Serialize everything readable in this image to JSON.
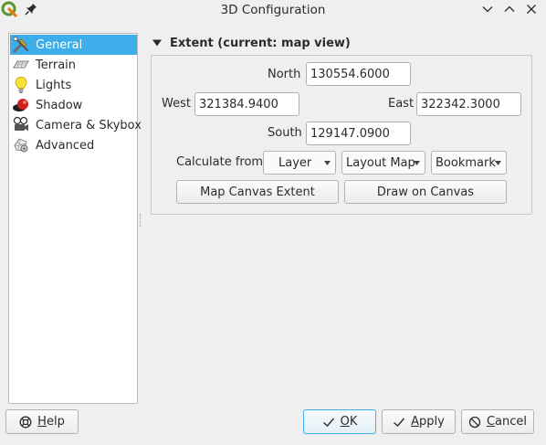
{
  "window": {
    "title": "3D Configuration"
  },
  "sidebar": {
    "items": [
      {
        "label": "General",
        "icon": "general-icon",
        "selected": true
      },
      {
        "label": "Terrain",
        "icon": "terrain-icon",
        "selected": false
      },
      {
        "label": "Lights",
        "icon": "lightbulb-icon",
        "selected": false
      },
      {
        "label": "Shadow",
        "icon": "shadow-icon",
        "selected": false
      },
      {
        "label": "Camera & Skybox",
        "icon": "camera-icon",
        "selected": false
      },
      {
        "label": "Advanced",
        "icon": "advanced-icon",
        "selected": false
      }
    ]
  },
  "extent": {
    "title": "Extent (current: map view)",
    "north_label": "North",
    "north_value": "130554.6000",
    "west_label": "West",
    "west_value": "321384.9400",
    "east_label": "East",
    "east_value": "322342.3000",
    "south_label": "South",
    "south_value": "129147.0900",
    "calculate_from_label": "Calculate from",
    "layer_combo": "Layer",
    "layout_map_combo": "Layout Map",
    "bookmark_combo": "Bookmark",
    "map_canvas_extent_button": "Map Canvas Extent",
    "draw_on_canvas_button": "Draw on Canvas"
  },
  "buttons": {
    "help_mnemonic": "H",
    "help_rest": "elp",
    "ok_mnemonic": "O",
    "ok_rest": "K",
    "apply_mnemonic": "A",
    "apply_rest": "pply",
    "cancel_mnemonic": "C",
    "cancel_rest": "ancel"
  },
  "colors": {
    "selection": "#3daee9",
    "window_bg": "#efefef",
    "qgis_green": "#589632",
    "qgis_yellow": "#ee7913"
  }
}
